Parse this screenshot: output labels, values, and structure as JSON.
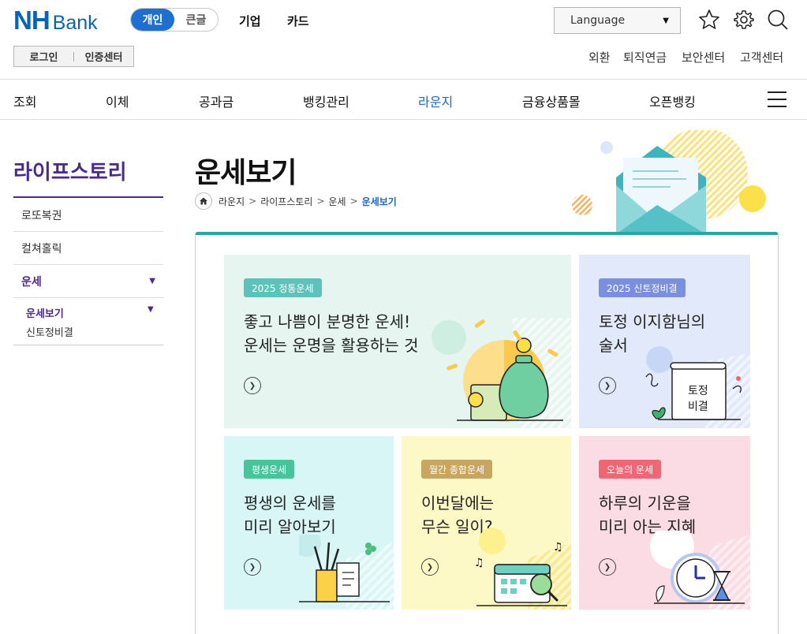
{
  "header": {
    "logo_nh": "NH",
    "logo_bank": "Bank",
    "mode_tabs": [
      "개인",
      "큰글"
    ],
    "top_menu": [
      "기업",
      "카드"
    ],
    "language_label": "Language",
    "auth": [
      "로그인",
      "인증센터"
    ],
    "utility_links": [
      "외환",
      "퇴직연금",
      "보안센터",
      "고객센터"
    ]
  },
  "nav": {
    "items": [
      "조회",
      "이체",
      "공과금",
      "뱅킹관리",
      "라운지",
      "금융상품몰",
      "오픈뱅킹"
    ],
    "active": "라운지"
  },
  "sidebar": {
    "title": "라이프스토리",
    "items": [
      "로또복권",
      "컬쳐홀릭",
      "운세"
    ],
    "sub_active": "운세보기",
    "sub_item": "신토정비결"
  },
  "page": {
    "title": "운세보기",
    "breadcrumb": [
      "라운지",
      "라이프스토리",
      "운세",
      "운세보기"
    ]
  },
  "cards": [
    {
      "badge": "2025 정통운세",
      "line1": "좋고 나쁨이 분명한 운세!",
      "line2": "운세는 운명을 활용하는 것",
      "bg": "#e6f5ef",
      "badge_color": "#5dc2bb"
    },
    {
      "badge": "2025 신토정비결",
      "line1": "토정 이지함님의",
      "line2": "술서",
      "bg": "#e1e9fb",
      "badge_color": "#7b8fe0",
      "book_text1": "토정",
      "book_text2": "비결"
    },
    {
      "badge": "평생운세",
      "line1": "평생의 운세를",
      "line2": "미리 알아보기",
      "bg": "#d8f6f6",
      "badge_color": "#47c49a"
    },
    {
      "badge": "월간 종합운세",
      "line1": "이번달에는",
      "line2": "무슨 일이?",
      "bg": "#fdf9c6",
      "badge_color": "#c9a65f"
    },
    {
      "badge": "오늘의 운세",
      "line1": "하루의 기운을",
      "line2": "미리 아는 지혜",
      "bg": "#fbdbe4",
      "badge_color": "#ef6675"
    }
  ],
  "colors": {
    "brand": "#0b63b6",
    "accent": "#1f67c2",
    "sidebar": "#4c2a8a",
    "teal": "#2aa6a6"
  }
}
